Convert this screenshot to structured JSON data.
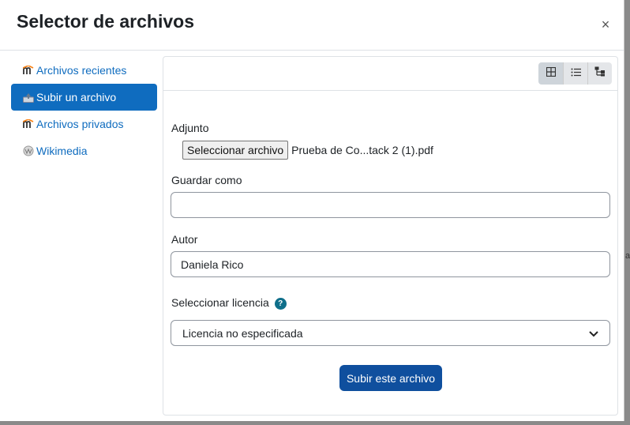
{
  "dialog": {
    "title": "Selector de archivos",
    "close_symbol": "×"
  },
  "sidebar": {
    "items": [
      {
        "label": "Archivos recientes",
        "icon": "moodle-icon",
        "active": false
      },
      {
        "label": "Subir un archivo",
        "icon": "upload-icon",
        "active": true
      },
      {
        "label": "Archivos privados",
        "icon": "moodle-icon",
        "active": false
      },
      {
        "label": "Wikimedia",
        "icon": "wikimedia-icon",
        "active": false
      }
    ]
  },
  "toolbar": {
    "views": [
      "grid-view-icon",
      "list-view-icon",
      "tree-view-icon"
    ]
  },
  "form": {
    "attachment_label": "Adjunto",
    "choose_file_label": "Seleccionar archivo",
    "file_name": "Prueba de Co...tack 2 (1).pdf",
    "save_as_label": "Guardar como",
    "save_as_value": "",
    "author_label": "Autor",
    "author_value": "Daniela Rico",
    "license_label": "Seleccionar licencia",
    "license_value": "Licencia no especificada",
    "submit_label": "Subir este archivo"
  },
  "colors": {
    "accent": "#0f6cbf",
    "submit": "#0f4f9e",
    "help": "#0f6f8a"
  }
}
